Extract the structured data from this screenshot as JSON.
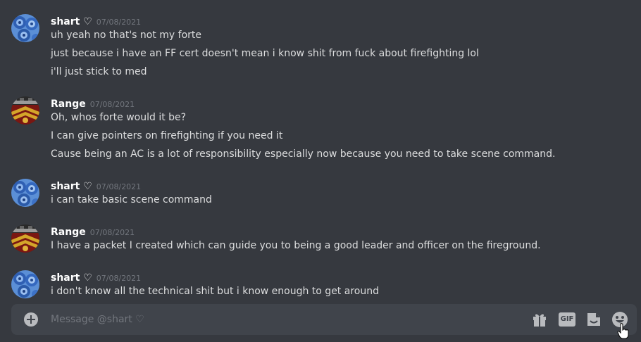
{
  "messages": [
    {
      "author": "shart ♡",
      "timestamp": "07/08/2021",
      "avatar": "blue-roses-avatar",
      "lines": [
        "uh yeah no that's not my forte",
        "just because i have an FF cert doesn't mean i know shit from fuck about firefighting lol",
        "i'll just stick to med"
      ]
    },
    {
      "author": "Range",
      "timestamp": "07/08/2021",
      "avatar": "fire-truck-avatar",
      "lines": [
        "Oh, whos forte would it be?",
        "I can give pointers on firefighting if you need it",
        "Cause being an AC is a lot of responsibility especially now because you need to take scene command."
      ]
    },
    {
      "author": "shart ♡",
      "timestamp": "07/08/2021",
      "avatar": "blue-roses-avatar",
      "lines": [
        "i can take basic scene command"
      ]
    },
    {
      "author": "Range",
      "timestamp": "07/08/2021",
      "avatar": "fire-truck-avatar",
      "lines": [
        "I have a packet I created which can guide you to being a good leader and officer on the fireground."
      ]
    },
    {
      "author": "shart ♡",
      "timestamp": "07/08/2021",
      "avatar": "blue-roses-avatar",
      "lines": [
        "i don't know all the technical shit but i know enough to get around"
      ]
    }
  ],
  "composer": {
    "placeholder": "Message @shart ♡",
    "gif_label": "GIF",
    "icons": [
      "plus-circle-icon",
      "gift-icon",
      "gif-icon",
      "sticker-icon",
      "emoji-icon"
    ]
  },
  "colors": {
    "background": "#36393f",
    "composer": "#40444b",
    "username": "#ffffff",
    "text": "#dcddde",
    "muted": "#72767d"
  }
}
